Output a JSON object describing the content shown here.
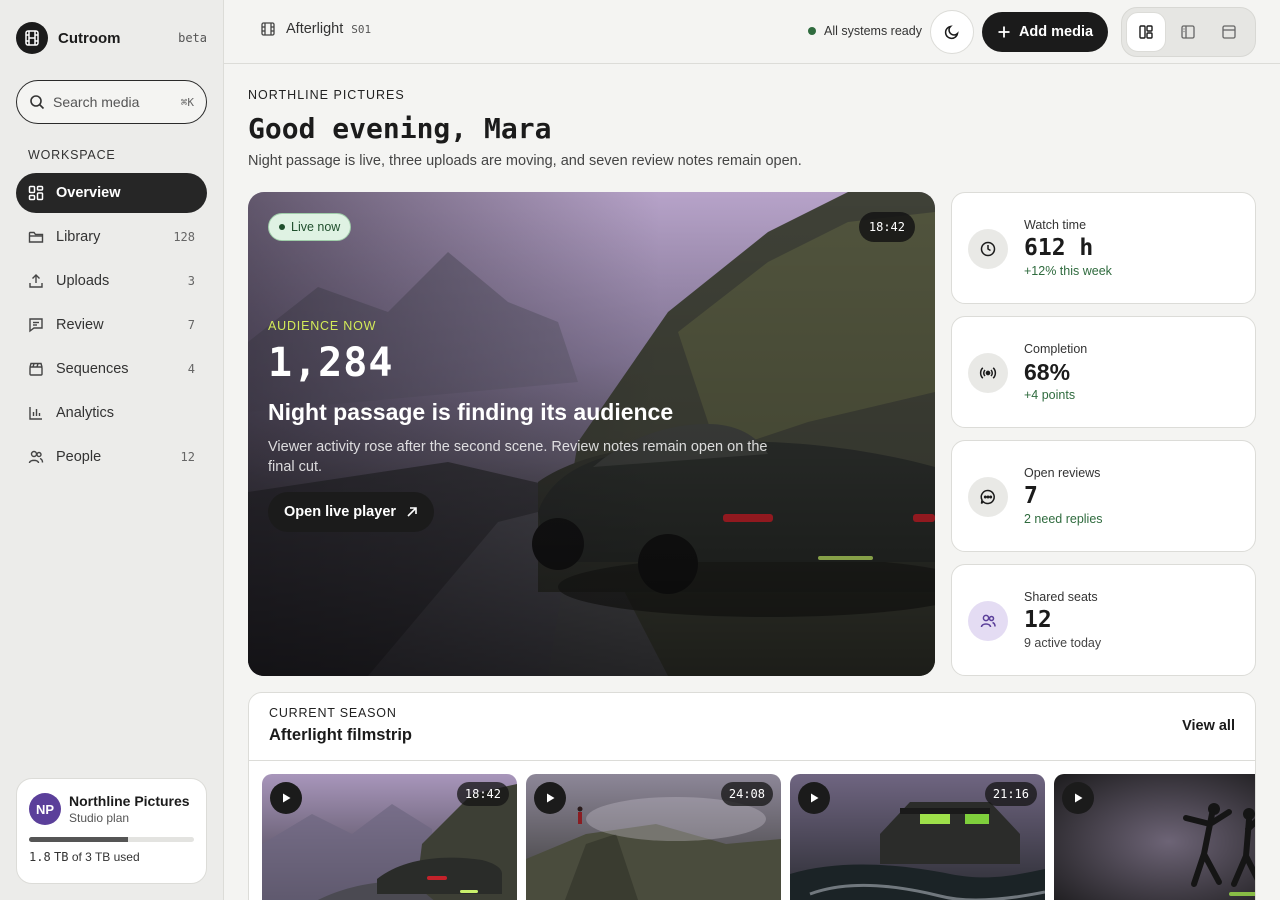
{
  "sidebar": {
    "brand": {
      "name": "Cutroom",
      "badge": "beta"
    },
    "search": {
      "placeholder": "Search media",
      "shortcut": "⌘K"
    },
    "section_label": "WORKSPACE",
    "items": [
      {
        "label": "Overview",
        "count": "",
        "icon": "grid-icon",
        "active": true
      },
      {
        "label": "Library",
        "count": "128",
        "icon": "folder-icon"
      },
      {
        "label": "Uploads",
        "count": "3",
        "icon": "upload-icon"
      },
      {
        "label": "Review",
        "count": "7",
        "icon": "comment-icon"
      },
      {
        "label": "Sequences",
        "count": "4",
        "icon": "clapperboard-icon"
      },
      {
        "label": "Analytics",
        "count": "",
        "icon": "bar-chart-icon"
      },
      {
        "label": "People",
        "count": "12",
        "icon": "people-icon"
      }
    ],
    "org": {
      "initials": "NP",
      "name": "Northline Pictures",
      "plan": "Studio plan",
      "storage_used_value": "1.8",
      "storage_used_unit": "TB",
      "storage_rest": "of 3 TB used",
      "storage_fraction": 0.6
    }
  },
  "topbar": {
    "title": "Afterlight",
    "episode": "S01",
    "status": "All systems ready",
    "add_label": "Add media"
  },
  "main": {
    "eyebrow": "NORTHLINE PICTURES",
    "greeting": "Good evening, Mara",
    "subline": "Night passage is live, three uploads are moving, and seven review notes remain open."
  },
  "hero": {
    "live_label": "Live now",
    "duration": "18:42",
    "eyebrow": "AUDIENCE NOW",
    "number": "1,284",
    "title": "Night passage is finding its audience",
    "description": "Viewer activity rose after the second scene. Review notes remain open on the final cut.",
    "cta": "Open live player"
  },
  "stats": [
    {
      "label": "Watch time",
      "value": "612 h",
      "sub": "+12% this week",
      "icon": "clock-icon"
    },
    {
      "label": "Completion",
      "value": "68%",
      "sub": "+4 points",
      "icon": "broadcast-icon"
    },
    {
      "label": "Open reviews",
      "value": "7",
      "sub": "2 need replies",
      "icon": "chat-bubble-icon"
    },
    {
      "label": "Shared seats",
      "value": "12",
      "sub": "9 active today",
      "icon": "people-icon"
    }
  ],
  "season": {
    "eyebrow": "CURRENT SEASON",
    "title": "Afterlight filmstrip",
    "view_all": "View all",
    "thumbs": [
      {
        "duration": "18:42"
      },
      {
        "duration": "24:08"
      },
      {
        "duration": "21:16"
      },
      {
        "duration": ""
      }
    ]
  },
  "colors": {
    "accent_dark": "#1b1b1b",
    "live_green": "#2f6b3e",
    "hero_eyebrow": "#d3ea58",
    "avatar_purple": "#5b3f9a"
  }
}
